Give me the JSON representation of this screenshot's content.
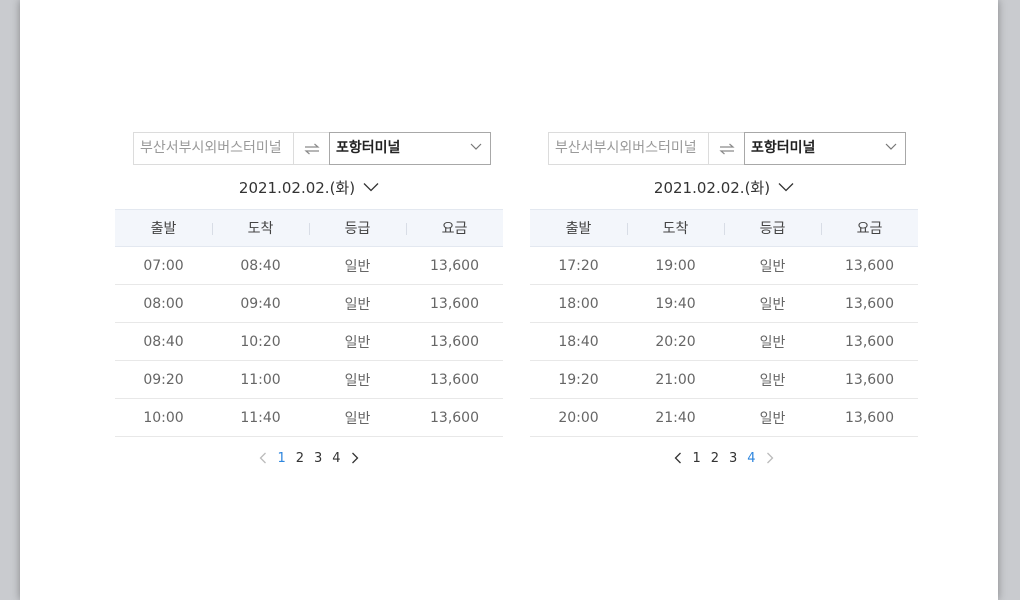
{
  "panels": [
    {
      "from": "부산서부시외버스터미널",
      "to": "포항터미널",
      "date": "2021.02.02.(화)",
      "headers": [
        "출발",
        "도착",
        "등급",
        "요금"
      ],
      "rows": [
        [
          "07:00",
          "08:40",
          "일반",
          "13,600"
        ],
        [
          "08:00",
          "09:40",
          "일반",
          "13,600"
        ],
        [
          "08:40",
          "10:20",
          "일반",
          "13,600"
        ],
        [
          "09:20",
          "11:00",
          "일반",
          "13,600"
        ],
        [
          "10:00",
          "11:40",
          "일반",
          "13,600"
        ]
      ],
      "pages": [
        "1",
        "2",
        "3",
        "4"
      ],
      "active_page": "1"
    },
    {
      "from": "부산서부시외버스터미널",
      "to": "포항터미널",
      "date": "2021.02.02.(화)",
      "headers": [
        "출발",
        "도착",
        "등급",
        "요금"
      ],
      "rows": [
        [
          "17:20",
          "19:00",
          "일반",
          "13,600"
        ],
        [
          "18:00",
          "19:40",
          "일반",
          "13,600"
        ],
        [
          "18:40",
          "20:20",
          "일반",
          "13,600"
        ],
        [
          "19:20",
          "21:00",
          "일반",
          "13,600"
        ],
        [
          "20:00",
          "21:40",
          "일반",
          "13,600"
        ]
      ],
      "pages": [
        "1",
        "2",
        "3",
        "4"
      ],
      "active_page": "4"
    }
  ],
  "colors": {
    "accent": "#2e86de",
    "header_bg": "#f3f6fb",
    "disabled_arrow": "#bbbbbb"
  },
  "icons": {
    "swap": "swap-arrows-icon",
    "dropdown": "chevron-down-icon",
    "prev": "chevron-left-icon",
    "next": "chevron-right-icon"
  }
}
